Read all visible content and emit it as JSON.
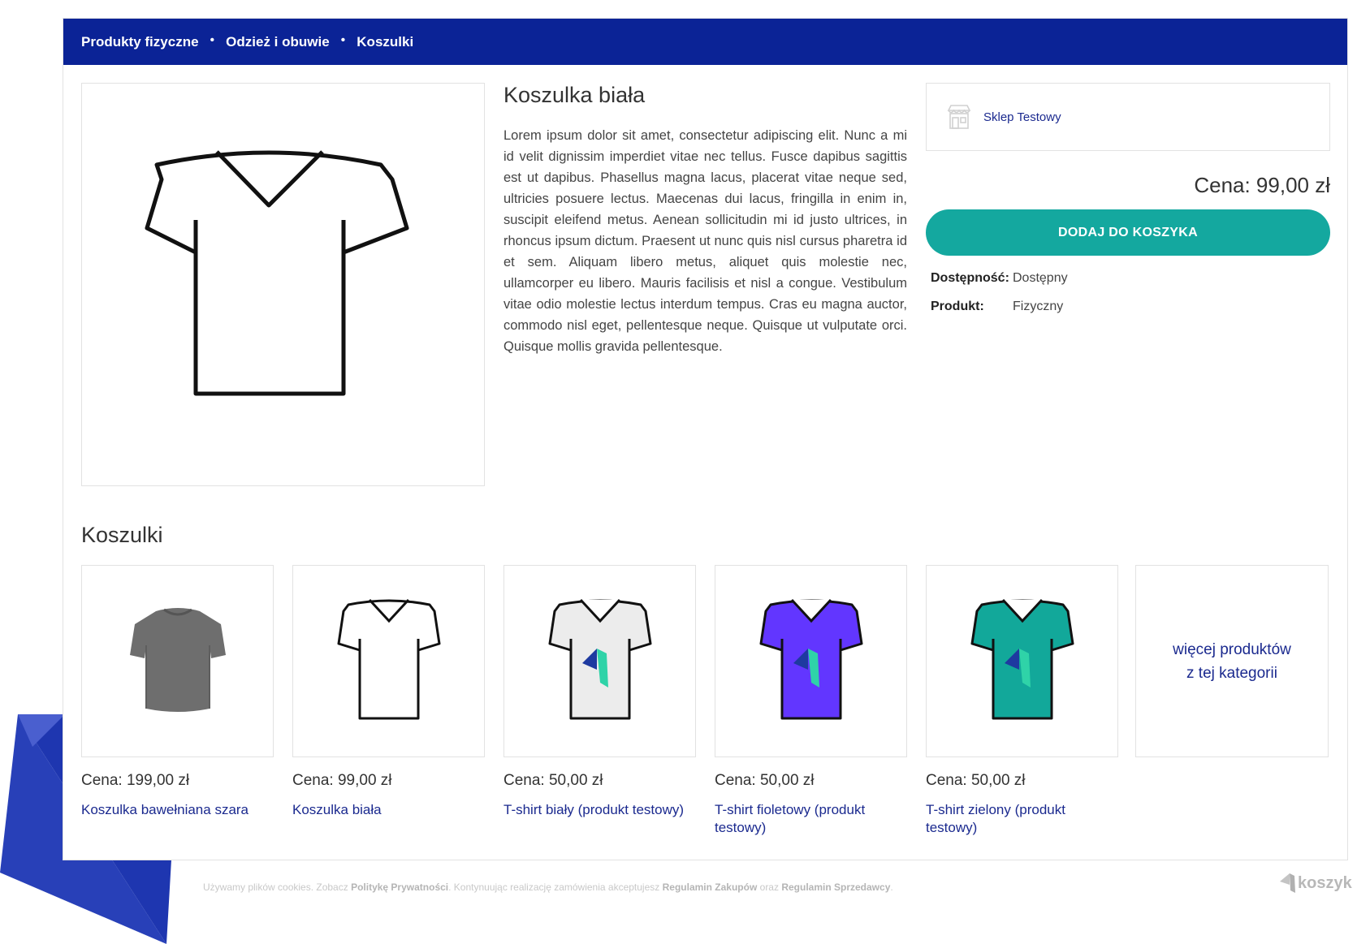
{
  "breadcrumb": {
    "items": [
      "Produkty fizyczne",
      "Odzież i obuwie",
      "Koszulki"
    ],
    "separator": "•"
  },
  "product": {
    "title": "Koszulka biała",
    "description": "Lorem ipsum dolor sit amet, consectetur adipiscing elit. Nunc a mi id velit dignissim imperdiet vitae nec tellus. Fusce dapibus sagittis est ut dapibus. Phasellus magna lacus, placerat vitae neque sed, ultricies posuere lectus. Maecenas dui lacus, fringilla in enim in, suscipit eleifend metus. Aenean sollicitudin mi id justo ultrices, in rhoncus ipsum dictum. Praesent ut nunc quis nisl cursus pharetra id et sem. Aliquam libero metus, aliquet quis molestie nec, ullamcorper eu libero. Mauris facilisis et nisl a congue. Vestibulum vitae odio molestie lectus interdum tempus. Cras eu magna auctor, commodo nisl eget, pellentesque neque. Quisque ut vulputate orci. Quisque mollis gravida pellentesque.",
    "image_icon": "white-tshirt-icon"
  },
  "shop": {
    "name": "Sklep Testowy",
    "icon": "store-icon"
  },
  "price": "Cena: 99,00 zł",
  "add_to_cart_label": "DODAJ DO KOSZYKA",
  "attributes": [
    {
      "label": "Dostępność:",
      "value": "Dostępny"
    },
    {
      "label": "Produkt:",
      "value": "Fizyczny"
    }
  ],
  "related": {
    "title": "Koszulki",
    "items": [
      {
        "price": "Cena: 199,00 zł",
        "name": "Koszulka bawełniana szara",
        "icon": "grey-tshirt-icon"
      },
      {
        "price": "Cena: 99,00 zł",
        "name": "Koszulka biała",
        "icon": "white-tshirt-icon"
      },
      {
        "price": "Cena: 50,00 zł",
        "name": "T-shirt biały (produkt testowy)",
        "icon": "white-logo-tshirt-icon"
      },
      {
        "price": "Cena: 50,00 zł",
        "name": "T-shirt fioletowy (produkt testowy)",
        "icon": "violet-logo-tshirt-icon"
      },
      {
        "price": "Cena: 50,00 zł",
        "name": "T-shirt zielony (produkt testowy)",
        "icon": "green-logo-tshirt-icon"
      }
    ],
    "more_label": "więcej produktów z tej kategorii"
  },
  "footer": {
    "cookie_text_1": "Używamy plików cookies. Zobacz",
    "privacy_link": "Politykę Prywatności",
    "cookie_text_2": ". Kontynuując realizację zamówienia akceptujesz",
    "terms_link": "Regulamin Zakupów",
    "cookie_text_3": "oraz",
    "seller_terms_link": "Regulamin Sprzedawcy",
    "cookie_text_4": ".",
    "logo_text": "koszyk"
  },
  "colors": {
    "header_blue": "#0b2396",
    "button_teal": "#14a89f",
    "link_blue": "#1b2a8f",
    "violet": "#6236ff",
    "green": "#12a89a"
  }
}
